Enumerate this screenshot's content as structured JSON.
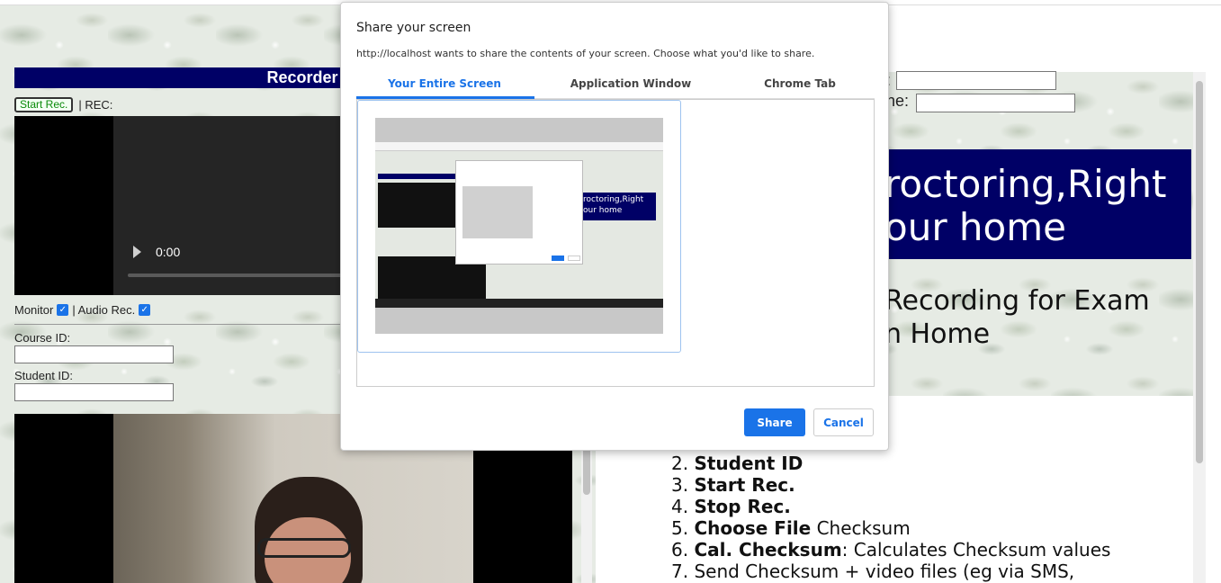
{
  "recorder": {
    "title": "Recorder",
    "start_label": "Start Rec.",
    "rec_label": "| REC:",
    "video_time": "0:00",
    "monitor_label": "Monitor",
    "audio_label": "| Audio Rec.",
    "course_label": "Course ID:",
    "student_label": "Student ID:"
  },
  "right": {
    "field1_label": ":",
    "field2_label": "ne:",
    "hero_line1": "roctoring,Right",
    "hero_line2": "our home",
    "sub_line1": "Recording for Exam",
    "sub_line2": "n Home",
    "steps": [
      {
        "num": "2.",
        "bold": "Student ID",
        "rest": ""
      },
      {
        "num": "3.",
        "bold": "Start Rec.",
        "rest": ""
      },
      {
        "num": "4.",
        "bold": "Stop Rec.",
        "rest": ""
      },
      {
        "num": "5.",
        "bold": "Choose File",
        "rest": " Checksum"
      },
      {
        "num": "6.",
        "bold": "Cal. Checksum",
        "rest": ": Calculates Checksum values"
      },
      {
        "num": "7.",
        "bold": "",
        "rest": "Send Checksum + video files (eg via SMS,"
      }
    ]
  },
  "dialog": {
    "title": "Share your screen",
    "description": "http://localhost wants to share the contents of your screen. Choose what you'd like to share.",
    "tabs": [
      "Your Entire Screen",
      "Application Window",
      "Chrome Tab"
    ],
    "active_tab": 0,
    "preview_hero": "roctoring,Right\nour home",
    "share_label": "Share",
    "cancel_label": "Cancel"
  },
  "colors": {
    "navy": "#000066",
    "accent": "#1a73e8"
  }
}
